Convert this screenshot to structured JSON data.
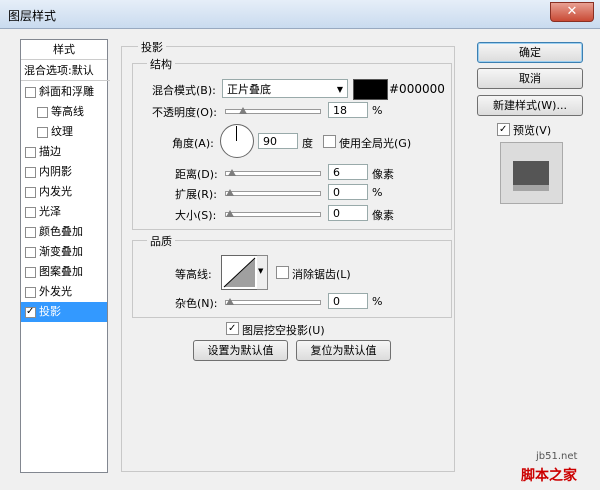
{
  "window": {
    "title": "图层样式",
    "close_label": "✕"
  },
  "left_panel": {
    "header": "样式",
    "blend_options": "混合选项:默认",
    "items": [
      {
        "label": "斜面和浮雕",
        "checked": false,
        "indent": false
      },
      {
        "label": "等高线",
        "checked": false,
        "indent": true
      },
      {
        "label": "纹理",
        "checked": false,
        "indent": true
      },
      {
        "label": "描边",
        "checked": false,
        "indent": false
      },
      {
        "label": "内阴影",
        "checked": false,
        "indent": false
      },
      {
        "label": "内发光",
        "checked": false,
        "indent": false
      },
      {
        "label": "光泽",
        "checked": false,
        "indent": false
      },
      {
        "label": "颜色叠加",
        "checked": false,
        "indent": false
      },
      {
        "label": "渐变叠加",
        "checked": false,
        "indent": false
      },
      {
        "label": "图案叠加",
        "checked": false,
        "indent": false
      },
      {
        "label": "外发光",
        "checked": false,
        "indent": false
      },
      {
        "label": "投影",
        "checked": true,
        "indent": false,
        "selected": true
      }
    ]
  },
  "shadow": {
    "section_title": "投影",
    "structure": {
      "title": "结构",
      "blend_mode_label": "混合模式(B):",
      "blend_mode_value": "正片叠底",
      "color_hex": "#000000",
      "opacity_label": "不透明度(O):",
      "opacity_value": "18",
      "opacity_unit": "%",
      "angle_label": "角度(A):",
      "angle_value": "90",
      "angle_unit": "度",
      "global_light_label": "使用全局光(G)",
      "distance_label": "距离(D):",
      "distance_value": "6",
      "distance_unit": "像素",
      "spread_label": "扩展(R):",
      "spread_value": "0",
      "spread_unit": "%",
      "size_label": "大小(S):",
      "size_value": "0",
      "size_unit": "像素"
    },
    "quality": {
      "title": "品质",
      "contour_label": "等高线:",
      "antialias_label": "消除锯齿(L)",
      "noise_label": "杂色(N):",
      "noise_value": "0",
      "noise_unit": "%"
    },
    "knockout_label": "图层挖空投影(U)",
    "set_default_label": "设置为默认值",
    "reset_default_label": "复位为默认值"
  },
  "right": {
    "ok_label": "确定",
    "cancel_label": "取消",
    "new_style_label": "新建样式(W)...",
    "preview_label": "预览(V)"
  },
  "watermark": {
    "site": "jb51.net",
    "name": "脚本之家"
  },
  "colors": {
    "selection": "#3399ff",
    "shadow_color": "#000000"
  }
}
